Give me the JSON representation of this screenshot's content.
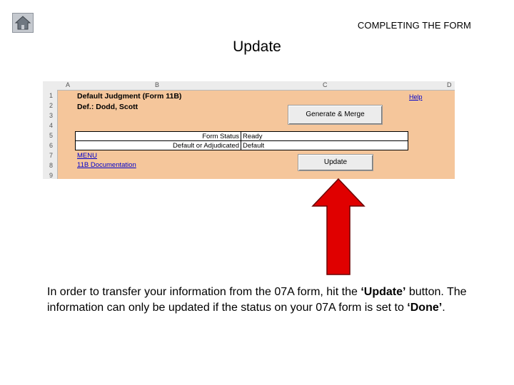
{
  "header": {
    "section_title": "COMPLETING THE FORM",
    "home_icon": "home-icon"
  },
  "slide": {
    "title": "Update"
  },
  "spreadsheet": {
    "columns": [
      "A",
      "B",
      "C",
      "D"
    ],
    "rows": [
      "1",
      "2",
      "3",
      "4",
      "5",
      "6",
      "7",
      "8",
      "9"
    ],
    "form_title": "Default Judgment (Form 11B)",
    "defendant": "Def.: Dodd, Scott",
    "help_link": "Help",
    "generate_button": "Generate & Merge",
    "fields": [
      {
        "label": "Form Status",
        "value": "Ready"
      },
      {
        "label": "Default or Adjudicated",
        "value": "Default"
      }
    ],
    "menu_link": "MENU",
    "doc_link": "11B Documentation",
    "update_button": "Update"
  },
  "caption": {
    "line_start": "In order to transfer your information from the 07A form, hit the ",
    "update_word": "‘Update’",
    "line_middle": " button. The information can only be updated if the status on your 07A form is set to ",
    "done_word": "‘Done’",
    "line_end": "."
  },
  "colors": {
    "sheet_bg": "#f5c69b",
    "arrow_fill": "#e00000",
    "link": "#0000cc"
  }
}
